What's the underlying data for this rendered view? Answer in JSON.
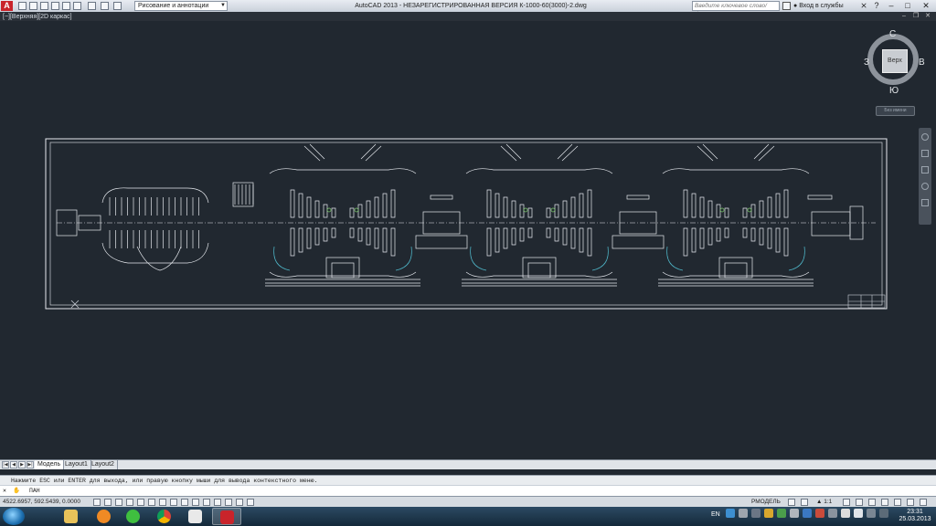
{
  "app": {
    "logo_text": "A",
    "window_title": "AutoCAD 2013 - НЕЗАРЕГИСТРИРОВАННАЯ ВЕРСИЯ   К-1000-60(3000)-2.dwg",
    "workspace": "Рисование и аннотации",
    "search_placeholder": "Введите ключевое слово/фразу",
    "sign_in": "Вход в службы",
    "help": "?"
  },
  "viewport": {
    "label": "[−][Верхняя][2D каркас]"
  },
  "viewcube": {
    "north": "С",
    "south": "Ю",
    "east": "В",
    "west": "З",
    "face": "Верх",
    "wcs": "Без имени"
  },
  "layout_tabs": {
    "tabs": [
      "Модель",
      "Layout1",
      "Layout2"
    ]
  },
  "command": {
    "history_line": "Нажмите ESC или ENTER для выхода, или правую кнопку мыши для вывода контекстного меню.",
    "current_command": "ПАН"
  },
  "status_bar": {
    "coordinates": "4522.6957, 592.5439, 0.0000",
    "space": "РМОДЕЛЬ",
    "annotation_scale": "1:1"
  },
  "taskbar": {
    "language": "EN",
    "time": "23:31",
    "date": "25.03.2013",
    "apps": [
      "windows-explorer",
      "windows-media-player",
      "icq",
      "google-chrome",
      "7-zip",
      "autocad"
    ]
  },
  "colors": {
    "canvas": "#212830",
    "linework": "#e6e9ee",
    "accent_cyan": "#4fb7c9",
    "accent_green": "#7fd36b",
    "taskbar": "#1c3347"
  }
}
